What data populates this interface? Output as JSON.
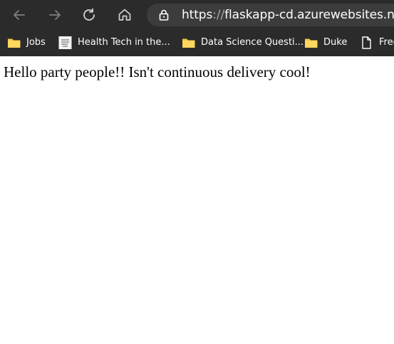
{
  "browser": {
    "url_scheme": "https",
    "url_separator": "://",
    "url_host": "flaskapp-cd.azurewebsites.net",
    "toolbar_background": "#2b2b2b",
    "address_background": "#3c3c3c",
    "icon_color": "#c8c8c8"
  },
  "bookmarks": [
    {
      "label": "Jobs",
      "icon": "folder-icon"
    },
    {
      "label": "Health Tech in the...",
      "icon": "site-favicon-icon"
    },
    {
      "label": "Data Science Questi...",
      "icon": "folder-icon"
    },
    {
      "label": "Duke",
      "icon": "folder-icon"
    },
    {
      "label": "Free",
      "icon": "page-icon"
    }
  ],
  "page": {
    "message": "Hello party people!! Isn't continuous delivery cool!"
  }
}
